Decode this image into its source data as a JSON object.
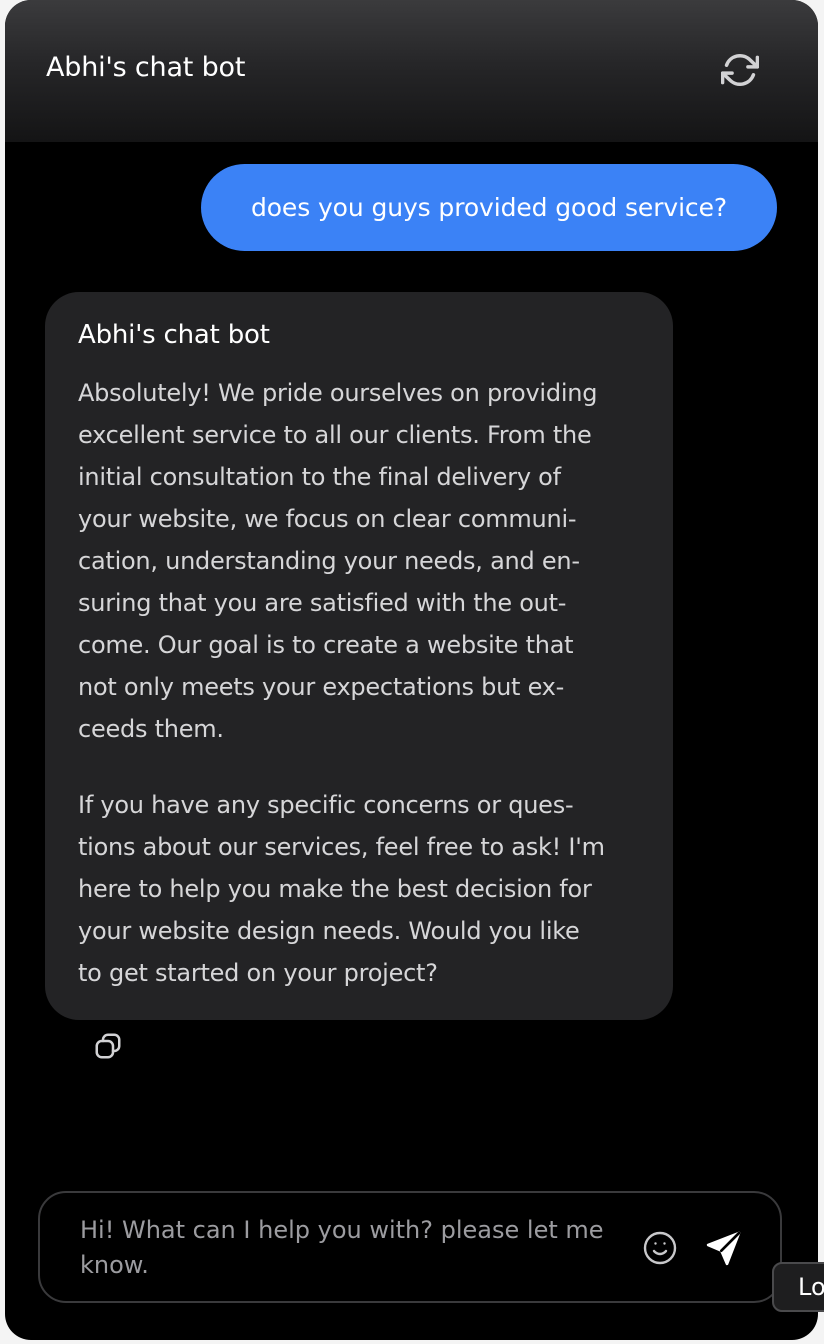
{
  "header": {
    "title": "Abhi's chat bot",
    "refresh_icon": "refresh-icon"
  },
  "messages": {
    "user": {
      "text": "does you guys provided good service?"
    },
    "bot": {
      "name": "Abhi's chat bot",
      "paragraph1_lines": [
        "Absolutely! We pride ourselves on providing",
        "excellent service to all our clients. From the",
        "initial consultation to the final delivery of",
        "your website, we focus on clear communi-",
        "cation, understanding your needs, and en-",
        "suring that you are satisfied with the out-",
        "come. Our goal is to create a website that",
        "not only meets your expectations but ex-",
        "ceeds them."
      ],
      "paragraph2_lines": [
        "If you have any specific concerns or ques-",
        "tions about our services, feel free to ask! I'm",
        "here to help you make the best decision for",
        "your website design needs. Would you like",
        "to get started on your project?"
      ],
      "copy_icon": "copy-icon"
    }
  },
  "composer": {
    "placeholder": "Hi! What can I help you with? please let me know.",
    "value": "",
    "emoji_icon": "smiley-icon",
    "send_icon": "send-icon"
  },
  "edge_tab": {
    "label": "Lo"
  },
  "colors": {
    "user_bubble": "#3b82f6",
    "bot_bubble": "#232325",
    "background": "#000000"
  }
}
